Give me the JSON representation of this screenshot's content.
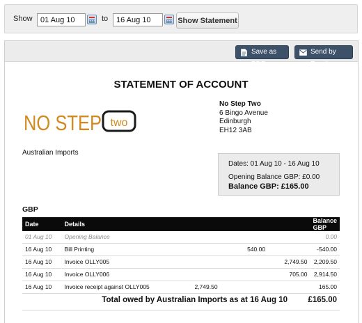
{
  "filter": {
    "show_label": "Show",
    "from_value": "01 Aug 10",
    "to_label": "to",
    "to_value": "16 Aug 10",
    "show_button_label": "Show Statement"
  },
  "toolbar": {
    "save_pdf_label": "Save as PDF",
    "send_email_label": "Send by Email",
    "button_color": "#3d5168"
  },
  "statement": {
    "title": "STATEMENT OF ACCOUNT",
    "logo": {
      "left_text": "NO STEP",
      "badge_text": "two",
      "brand_color": "#d08a20"
    },
    "company": {
      "name": "No Step Two",
      "address_lines": [
        "6 Bingo Avenue",
        "Edinburgh",
        "EH12 3AB"
      ]
    },
    "customer": "Australian Imports",
    "summary": {
      "dates": "Dates: 01 Aug 10 - 16 Aug 10",
      "opening": "Opening Balance GBP: £0.00",
      "balance": "Balance GBP: £165.00"
    },
    "currency": "GBP",
    "table": {
      "headers": {
        "date": "Date",
        "details": "Details",
        "balance": "Balance GBP"
      },
      "rows": [
        {
          "date": "01 Aug 10",
          "details": "Opening Balance",
          "a": "",
          "b": "",
          "c": "",
          "balance": "0.00",
          "opening": true
        },
        {
          "date": "16 Aug 10",
          "details": "Bill Printing",
          "a": "",
          "b": "540.00",
          "c": "",
          "balance": "-540.00"
        },
        {
          "date": "16 Aug 10",
          "details": "Invoice OLLY005",
          "a": "",
          "b": "",
          "c": "2,749.50",
          "balance": "2,209.50"
        },
        {
          "date": "16 Aug 10",
          "details": "Invoice OLLY006",
          "a": "",
          "b": "",
          "c": "705.00",
          "balance": "2,914.50"
        },
        {
          "date": "16 Aug 10",
          "details": "Invoice receipt against OLLY005",
          "a": "2,749.50",
          "b": "",
          "c": "",
          "balance": "165.00"
        }
      ]
    },
    "total_label": "Total owed by Australian Imports as at 16 Aug 10",
    "total_amount": "£165.00"
  }
}
